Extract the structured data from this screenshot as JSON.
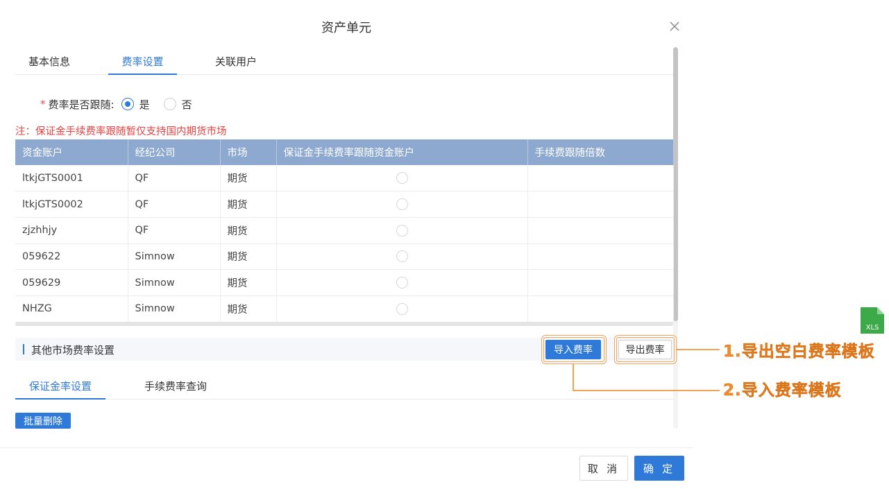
{
  "dialog": {
    "title": "资产单元",
    "close_icon": "close-icon"
  },
  "tabs_top": [
    {
      "label": "基本信息"
    },
    {
      "label": "费率设置"
    },
    {
      "label": "关联用户"
    }
  ],
  "follow": {
    "required_mark": "*",
    "label": "费率是否跟随:",
    "options": [
      {
        "label": "是",
        "checked": true
      },
      {
        "label": "否",
        "checked": false
      }
    ]
  },
  "note": "注：保证金手续费率跟随暂仅支持国内期货市场",
  "table": {
    "headers": [
      "资金账户",
      "经纪公司",
      "市场",
      "保证金手续费率跟随资金账户",
      "手续费跟随倍数"
    ],
    "rows": [
      [
        "ltkjGTS0001",
        "QF",
        "期货",
        "",
        ""
      ],
      [
        "ltkjGTS0002",
        "QF",
        "期货",
        "",
        ""
      ],
      [
        "zjzhhjy",
        "QF",
        "期货",
        "",
        ""
      ],
      [
        "059622",
        "Simnow",
        "期货",
        "",
        ""
      ],
      [
        "059629",
        "Simnow",
        "期货",
        "",
        ""
      ],
      [
        "NHZG",
        "Simnow",
        "期货",
        "",
        ""
      ]
    ]
  },
  "section": {
    "title": "其他市场费率设置",
    "import_label": "导入费率",
    "export_label": "导出费率"
  },
  "annotations": {
    "export_note": "1.导出空白费率模板",
    "import_note": "2.导入费率模板",
    "color": "#f08c2a"
  },
  "tabs_bottom": [
    {
      "label": "保证金率设置"
    },
    {
      "label": "手续费率查询"
    }
  ],
  "batch_delete_label": "批量删除",
  "footer": {
    "cancel_label": "取 消",
    "ok_label": "确 定"
  },
  "xls_icon": {
    "label": "XLS",
    "color": "#3daa4a"
  },
  "accent_color": "#2f7ad8"
}
